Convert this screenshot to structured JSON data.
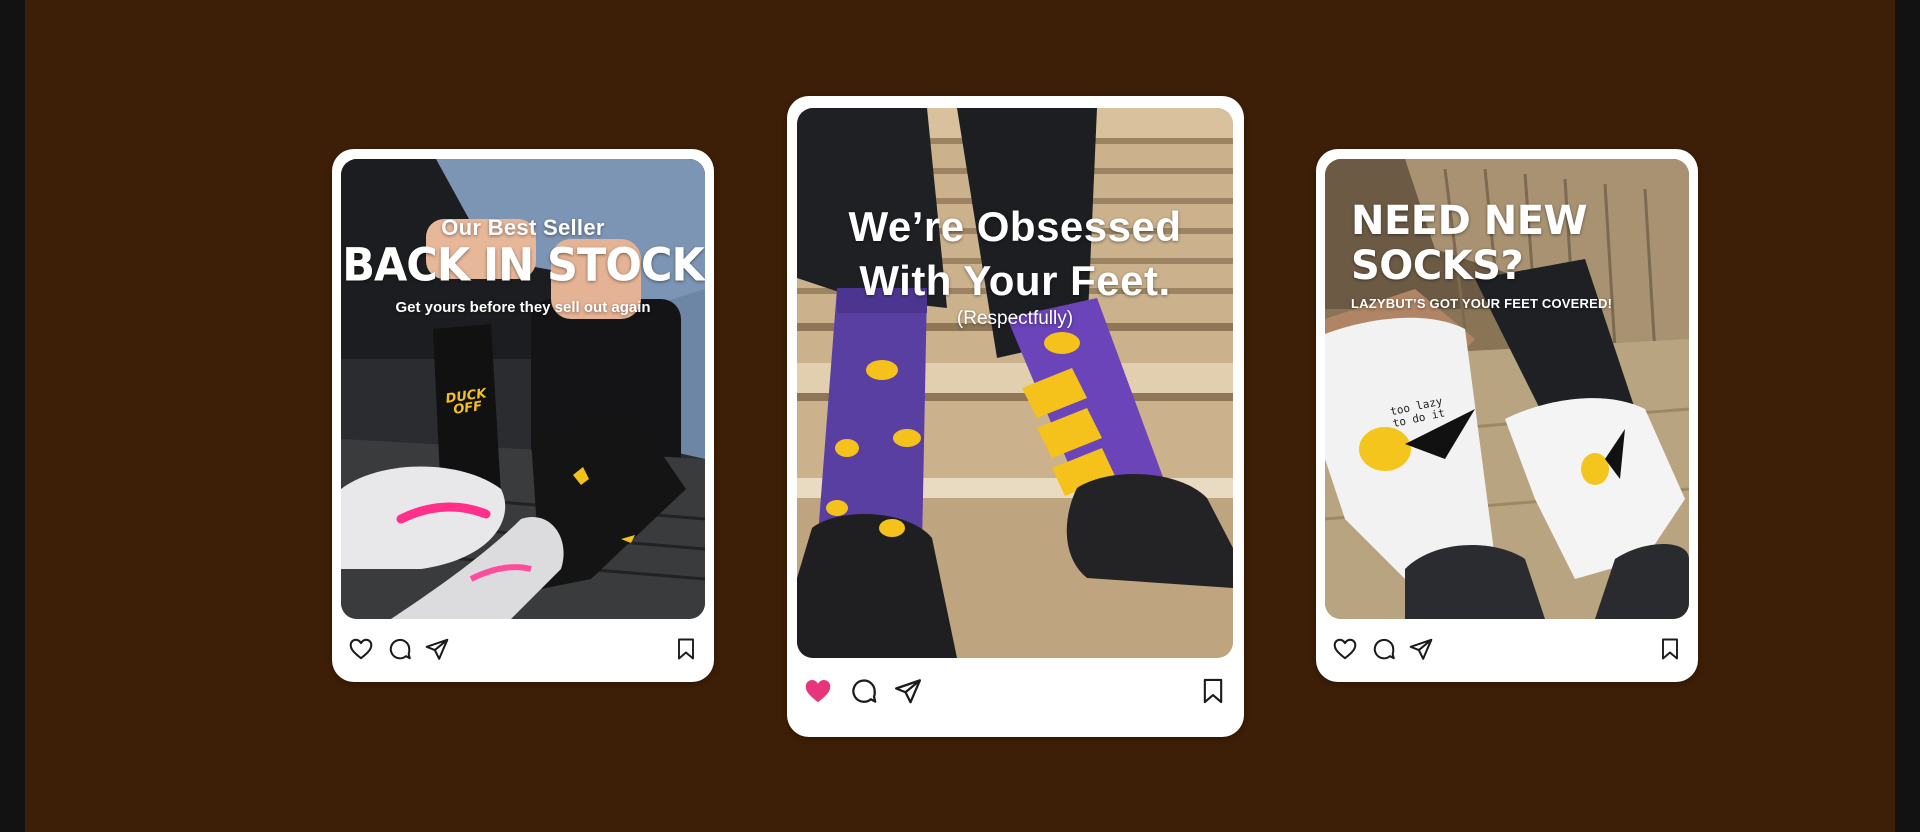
{
  "posts": [
    {
      "headline_small": "Our Best Seller",
      "headline_big": "BACK IN STOCK",
      "subline": "Get yours before they sell out again",
      "sock_text": "DUCK OFF",
      "liked": false,
      "icons": [
        "heart-icon",
        "comment-icon",
        "share-icon",
        "bookmark-icon"
      ]
    },
    {
      "headline_line1": "We’re Obsessed",
      "headline_line2": "With Your Feet.",
      "subline": "(Respectfully)",
      "liked": true,
      "icons": [
        "heart-icon",
        "comment-icon",
        "share-icon",
        "bookmark-icon"
      ]
    },
    {
      "headline_line1": "NEED NEW",
      "headline_line2": "SOCKS?",
      "subline": "LAZYBUT’S GOT YOUR FEET COVERED!",
      "sock_text": "too lazy to do it",
      "liked": false,
      "icons": [
        "heart-icon",
        "comment-icon",
        "share-icon",
        "bookmark-icon"
      ]
    }
  ],
  "colors": {
    "background": "#3d1e06",
    "outer": "#121212",
    "card": "#ffffff",
    "like_active": "#e8347a",
    "icon": "#1b1b1b"
  }
}
